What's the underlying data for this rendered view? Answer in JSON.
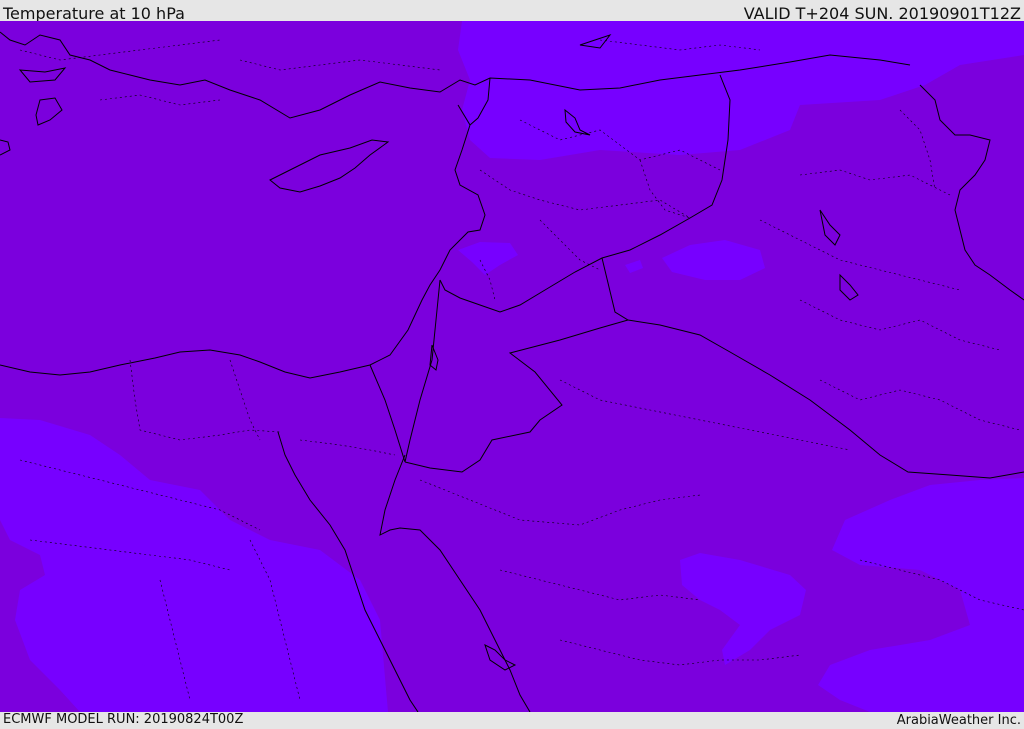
{
  "header": {
    "title": "Temperature at 10 hPa",
    "valid": "VALID T+204 SUN. 20190901T12Z"
  },
  "footer": {
    "model_run": "ECMWF MODEL RUN: 20190824T00Z",
    "credit": "ArabiaWeather Inc."
  },
  "colors": {
    "base_field": "#7b00dd",
    "cold_field": "#7700ff",
    "border_line": "#000000",
    "bar_background": "#e6e6e6"
  }
}
